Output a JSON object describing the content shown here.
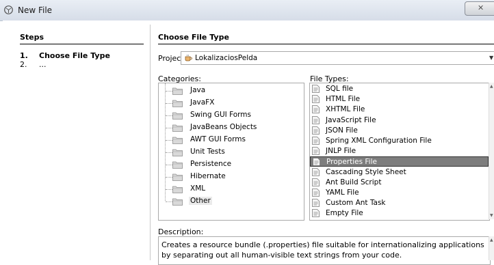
{
  "window": {
    "title": "New File"
  },
  "steps": {
    "heading": "Steps",
    "items": [
      {
        "num": "1.",
        "label": "Choose File Type"
      },
      {
        "num": "2.",
        "label": "..."
      }
    ]
  },
  "panel": {
    "heading": "Choose File Type"
  },
  "project": {
    "label": "Project:",
    "value": "LokalizaciosPelda"
  },
  "categories": {
    "label": "Categories:",
    "items": [
      "Java",
      "JavaFX",
      "Swing GUI Forms",
      "JavaBeans Objects",
      "AWT GUI Forms",
      "Unit Tests",
      "Persistence",
      "Hibernate",
      "XML",
      "Other"
    ],
    "selected": "Other"
  },
  "file_types": {
    "label": "File Types:",
    "items": [
      {
        "label": "SQL file",
        "icon": "sql-file-icon"
      },
      {
        "label": "HTML File",
        "icon": "html-file-icon"
      },
      {
        "label": "XHTML File",
        "icon": "xhtml-file-icon"
      },
      {
        "label": "JavaScript File",
        "icon": "javascript-file-icon"
      },
      {
        "label": "JSON File",
        "icon": "json-file-icon"
      },
      {
        "label": "Spring XML Configuration File",
        "icon": "spring-xml-file-icon"
      },
      {
        "label": "JNLP File",
        "icon": "jnlp-file-icon"
      },
      {
        "label": "Properties File",
        "icon": "properties-file-icon"
      },
      {
        "label": "Cascading Style Sheet",
        "icon": "css-file-icon"
      },
      {
        "label": "Ant Build Script",
        "icon": "ant-build-icon"
      },
      {
        "label": "YAML File",
        "icon": "yaml-file-icon"
      },
      {
        "label": "Custom Ant Task",
        "icon": "ant-task-icon"
      },
      {
        "label": "Empty File",
        "icon": "empty-file-icon"
      }
    ],
    "selected": "Properties File"
  },
  "description": {
    "label": "Description:",
    "text": "Creates a resource bundle (.properties) file suitable for internationalizing applications by separating out all human-visible text strings from your code."
  },
  "colors": {
    "selection": "#7d7d7d",
    "border": "#a9a9a9",
    "titlebar": "#dfe5ee"
  }
}
